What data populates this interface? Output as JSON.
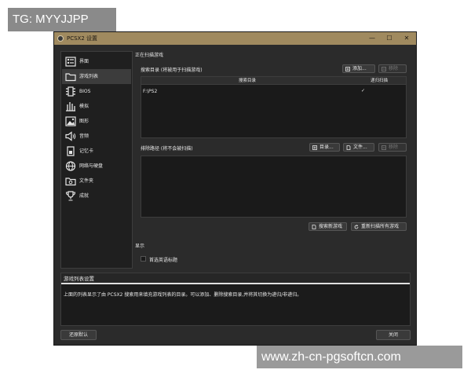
{
  "watermarks": {
    "top": "TG: MYYJJPP",
    "bottom": "www.zh-cn-pgsoftcn.com"
  },
  "window": {
    "title": "PCSX2 设置"
  },
  "sidebar": {
    "items": [
      {
        "label": "界面",
        "icon": "interface-icon"
      },
      {
        "label": "游戏列表",
        "icon": "folder-icon",
        "selected": true
      },
      {
        "label": "BIOS",
        "icon": "chip-icon"
      },
      {
        "label": "模拟",
        "icon": "emulation-icon"
      },
      {
        "label": "图形",
        "icon": "image-icon"
      },
      {
        "label": "音频",
        "icon": "speaker-icon"
      },
      {
        "label": "记忆卡",
        "icon": "memory-card-icon"
      },
      {
        "label": "网络与硬盘",
        "icon": "globe-icon"
      },
      {
        "label": "文件夹",
        "icon": "folder-settings-icon"
      },
      {
        "label": "成就",
        "icon": "trophy-icon"
      }
    ]
  },
  "scan": {
    "group_title": "正在扫描游戏",
    "search_dirs": {
      "label": "搜索目录 (将被用于扫描游戏)",
      "add_button": "添加...",
      "remove_button": "移除",
      "columns": [
        "搜索目录",
        "递归扫描"
      ],
      "rows": [
        {
          "path": "F:\\PS2",
          "recursive": "✓"
        }
      ]
    },
    "exclude": {
      "label": "排除路径 (将不会被扫描)",
      "dir_button": "目录...",
      "file_button": "文件...",
      "remove_button": "移除"
    },
    "scan_new_button": "搜索新游戏",
    "rescan_all_button": "重新扫描所有游戏"
  },
  "display": {
    "group_title": "显示",
    "prefer_english_titles": "首选英语标题"
  },
  "description": {
    "title": "游戏列表设置",
    "text": "上面的列表显示了由 PCSX2 搜索用来填充游戏列表的目录。可以添加、删除搜索目录,并将其切换为递归/非递归。"
  },
  "footer": {
    "restore_defaults": "还原默认",
    "close": "关闭"
  }
}
